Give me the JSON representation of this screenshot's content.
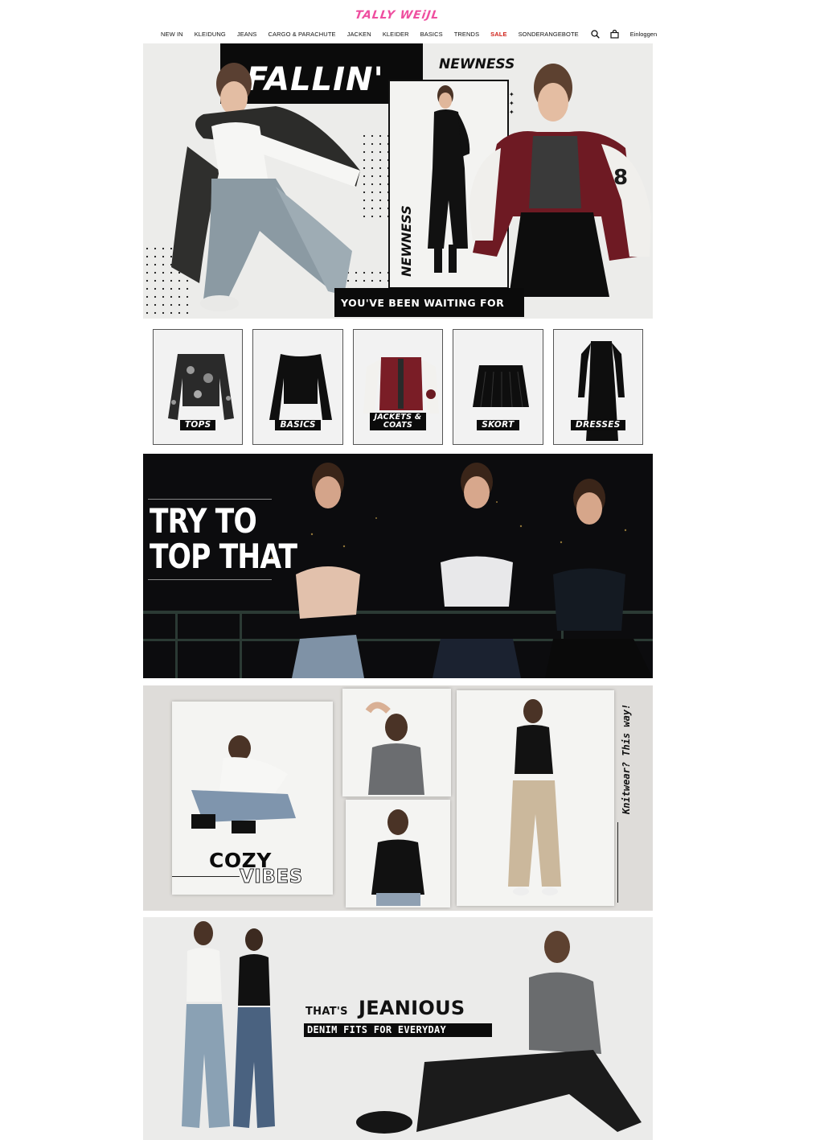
{
  "header": {
    "logo_text": "TALLY WEiJL",
    "logo_color": "#ef4fa0",
    "nav": [
      "NEW IN",
      "KLEIDUNG",
      "JEANS",
      "CARGO & PARACHUTE",
      "JACKEN",
      "KLEIDER",
      "BASICS",
      "TRENDS",
      "SALE",
      "SONDERANGEBOTE"
    ],
    "sale_color": "#d0231b",
    "icons": [
      "search-icon",
      "bag-icon"
    ],
    "login": "Einloggen"
  },
  "hero": {
    "title": "FALLIN'",
    "newness_top": "NEWNESS",
    "newness_vertical": "NEWNESS",
    "waiting": "YOU'VE BEEN WAITING FOR"
  },
  "categories": [
    {
      "label": "TOPS"
    },
    {
      "label": "BASICS"
    },
    {
      "label": "JACKETS &",
      "label2": "COATS"
    },
    {
      "label": "SKORT"
    },
    {
      "label": "DRESSES"
    }
  ],
  "night_banner": {
    "line1": "TRY TO",
    "line2": "TOP THAT"
  },
  "cozy_banner": {
    "title": "COZY",
    "subtitle": "VIBES",
    "side_text": "Knitwear? This way!"
  },
  "jeans_banner": {
    "prefix": "THAT'S",
    "title": "JEANIOUS",
    "subtitle": "DENIM FITS FOR EVERYDAY"
  }
}
